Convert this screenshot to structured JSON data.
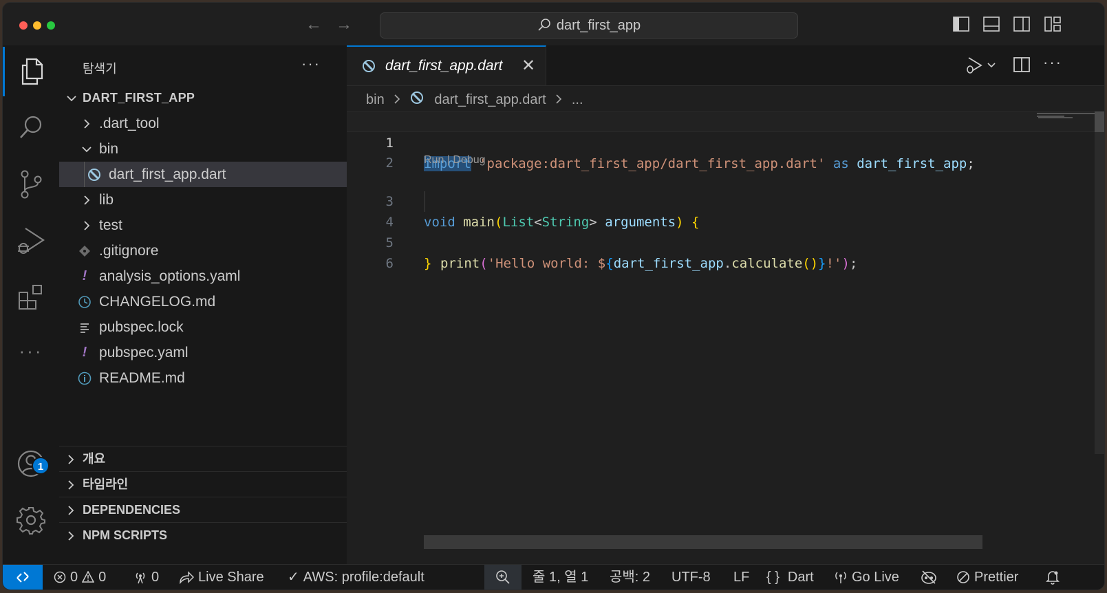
{
  "titlebar": {
    "search_text": "dart_first_app",
    "back_icon": "arrow-left-icon",
    "forward_icon": "arrow-right-icon"
  },
  "activity_bar": {
    "items": [
      "explorer-icon",
      "search-icon",
      "source-control-icon",
      "run-debug-icon",
      "extensions-icon",
      "more-icon"
    ],
    "accounts_badge": "1"
  },
  "sidebar": {
    "title": "탐색기",
    "root": "DART_FIRST_APP",
    "tree": [
      {
        "label": ".dart_tool",
        "type": "folder"
      },
      {
        "label": "bin",
        "type": "folder-open"
      },
      {
        "label": "dart_first_app.dart",
        "type": "dart-file"
      },
      {
        "label": "lib",
        "type": "folder"
      },
      {
        "label": "test",
        "type": "folder"
      },
      {
        "label": ".gitignore",
        "type": "git-file"
      },
      {
        "label": "analysis_options.yaml",
        "type": "yaml-file"
      },
      {
        "label": "CHANGELOG.md",
        "type": "changelog-file"
      },
      {
        "label": "pubspec.lock",
        "type": "lock-file"
      },
      {
        "label": "pubspec.yaml",
        "type": "yaml-file"
      },
      {
        "label": "README.md",
        "type": "info-file"
      }
    ],
    "sections": [
      "개요",
      "타임라인",
      "DEPENDENCIES",
      "NPM SCRIPTS"
    ]
  },
  "editor": {
    "tab_label": "dart_first_app.dart",
    "breadcrumb": [
      "bin",
      "dart_first_app.dart",
      "..."
    ],
    "codelens": "Run | Debug",
    "line_numbers": [
      "1",
      "2",
      "3",
      "4",
      "5",
      "6"
    ],
    "code": {
      "l1_import": "import",
      "l1_path": "'package:dart_first_app/dart_first_app.dart'",
      "l1_as": "as",
      "l1_alias": "dart_first_app",
      "l1_semi": ";",
      "l3_void": "void",
      "l3_main": "main",
      "l3_list": "List",
      "l3_string": "String",
      "l3_args": "arguments",
      "l4_print": "print",
      "l4_str1": "'Hello world: $",
      "l4_ident": "dart_first_app",
      "l4_calc": "calculate",
      "l4_str2": "!'",
      "l4_end": ");"
    }
  },
  "statusbar": {
    "errors": "0",
    "warnings": "0",
    "ports": "0",
    "live_share": "Live Share",
    "aws": "AWS: profile:default",
    "cursor": "줄 1, 열 1",
    "indent": "공백: 2",
    "encoding": "UTF-8",
    "eol": "LF",
    "language": "Dart",
    "go_live": "Go Live",
    "prettier": "Prettier"
  },
  "colors": {
    "accent": "#0078d4",
    "keyword": "#569cd6",
    "string": "#ce9178",
    "type": "#4ec9b0",
    "function": "#dcdcaa",
    "variable": "#9cdcfe"
  }
}
